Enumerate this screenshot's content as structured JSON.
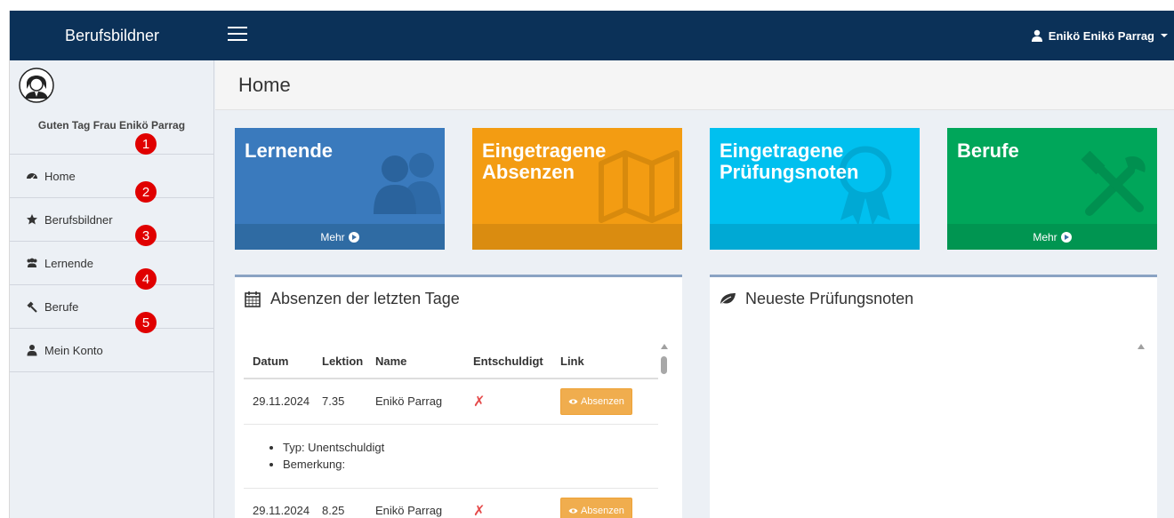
{
  "topbar": {
    "brand": "Berufsbildner",
    "user_name": "Enikö Enikö Parrag"
  },
  "sidebar": {
    "greeting": "Guten Tag Frau Enikö Parrag",
    "items": [
      {
        "label": "Home",
        "icon": "dashboard-icon"
      },
      {
        "label": "Berufsbildner",
        "icon": "star-icon"
      },
      {
        "label": "Lernende",
        "icon": "users-icon"
      },
      {
        "label": "Berufe",
        "icon": "gavel-icon"
      },
      {
        "label": "Mein Konto",
        "icon": "user-icon"
      }
    ],
    "badges": [
      "1",
      "2",
      "3",
      "4",
      "5"
    ]
  },
  "page": {
    "title": "Home"
  },
  "tiles": [
    {
      "title": "Lernende",
      "footer": "Mehr",
      "color": "#3a7abd",
      "footer_color": "#2f6ba3"
    },
    {
      "title": "Eingetragene Absenzen",
      "footer": "",
      "color": "#f39c12",
      "footer_color": "#da8c10"
    },
    {
      "title": "Eingetragene Prüfungsnoten",
      "footer": "",
      "color": "#00c0ef",
      "footer_color": "#00a9d4"
    },
    {
      "title": "Berufe",
      "footer": "Mehr",
      "color": "#00a65a",
      "footer_color": "#009551"
    }
  ],
  "absences_box": {
    "title": "Absenzen der letzten Tage",
    "columns": [
      "Datum",
      "Lektion",
      "Name",
      "Entschuldigt",
      "Link"
    ],
    "rows": [
      {
        "datum": "29.11.2024",
        "lektion": "7.35",
        "name": "Enikö Parrag",
        "entschuldigt": "✗",
        "link": "Absenzen"
      },
      {
        "datum": "29.11.2024",
        "lektion": "8.25",
        "name": "Enikö Parrag",
        "entschuldigt": "✗",
        "link": "Absenzen"
      }
    ],
    "details": [
      "Typ: Unentschuldigt",
      "Bemerkung:"
    ]
  },
  "grades_box": {
    "title": "Neueste Prüfungsnoten"
  },
  "colors": {
    "topbar": "#0b3158",
    "badge": "#e00000",
    "button": "#f0ad4e"
  }
}
